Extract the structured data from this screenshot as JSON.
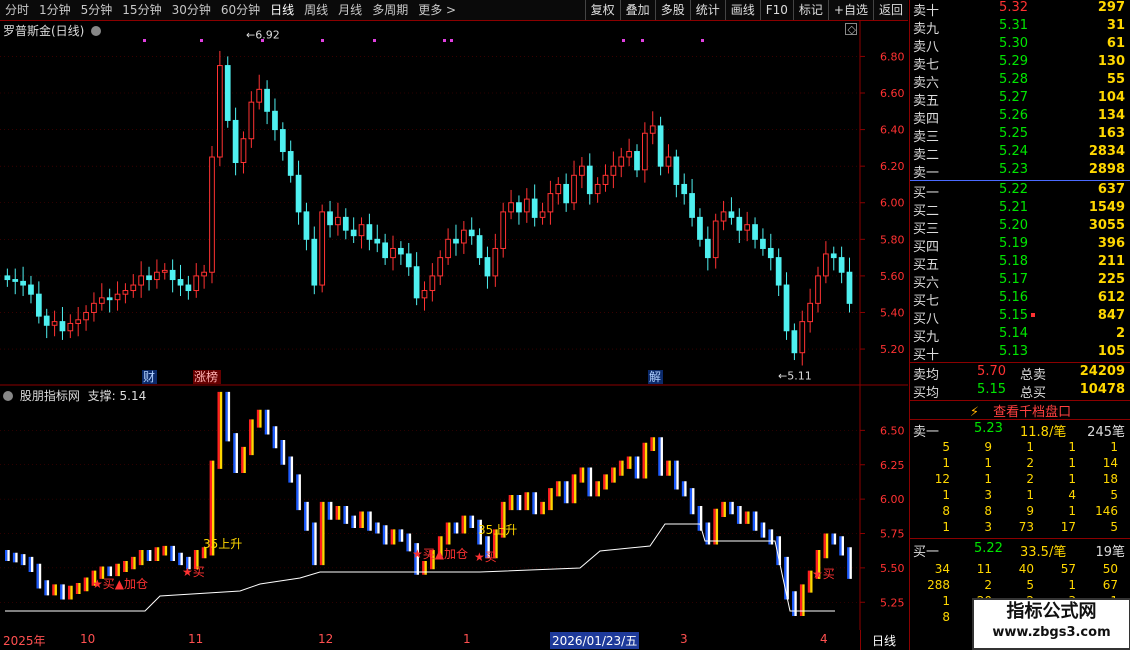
{
  "toolbar": {
    "periods": [
      "分时",
      "1分钟",
      "5分钟",
      "15分钟",
      "30分钟",
      "60分钟",
      "日线",
      "周线",
      "月线",
      "多周期",
      "更多 >"
    ],
    "active": "日线",
    "buttons": [
      "复权",
      "叠加",
      "多股",
      "统计",
      "画线",
      "F10",
      "标记",
      "+自选",
      "返回"
    ]
  },
  "main_chart": {
    "title": "罗普斯金(日线)",
    "y_ticks": [
      "6.80",
      "6.60",
      "6.40",
      "6.20",
      "6.00",
      "5.80",
      "5.60",
      "5.40",
      "5.20"
    ],
    "high_label": "6.92",
    "low_label": "5.11",
    "event_labels": [
      "财",
      "涨榜",
      "解"
    ]
  },
  "indicator": {
    "title": "股朋指标网",
    "support_label": "支撑: 5.14",
    "y_ticks": [
      "6.50",
      "6.25",
      "6.00",
      "5.75",
      "5.50",
      "5.25"
    ],
    "annotations": [
      "35上升",
      "35上升",
      "买▲加仓",
      "买",
      "买▲加仓",
      "买",
      "买"
    ]
  },
  "x_axis": {
    "labels": [
      "2025年",
      "10",
      "11",
      "12",
      "1",
      "2026/01/23/五",
      "3",
      "4"
    ],
    "period": "日线"
  },
  "order_book": {
    "asks": [
      {
        "label": "卖十",
        "price": "5.32",
        "vol": "297"
      },
      {
        "label": "卖九",
        "price": "5.31",
        "vol": "31"
      },
      {
        "label": "卖八",
        "price": "5.30",
        "vol": "61"
      },
      {
        "label": "卖七",
        "price": "5.29",
        "vol": "130"
      },
      {
        "label": "卖六",
        "price": "5.28",
        "vol": "55"
      },
      {
        "label": "卖五",
        "price": "5.27",
        "vol": "104"
      },
      {
        "label": "卖四",
        "price": "5.26",
        "vol": "134"
      },
      {
        "label": "卖三",
        "price": "5.25",
        "vol": "163"
      },
      {
        "label": "卖二",
        "price": "5.24",
        "vol": "2834"
      },
      {
        "label": "卖一",
        "price": "5.23",
        "vol": "2898"
      }
    ],
    "bids": [
      {
        "label": "买一",
        "price": "5.22",
        "vol": "637"
      },
      {
        "label": "买二",
        "price": "5.21",
        "vol": "1549"
      },
      {
        "label": "买三",
        "price": "5.20",
        "vol": "3055"
      },
      {
        "label": "买四",
        "price": "5.19",
        "vol": "396"
      },
      {
        "label": "买五",
        "price": "5.18",
        "vol": "211"
      },
      {
        "label": "买六",
        "price": "5.17",
        "vol": "225"
      },
      {
        "label": "买七",
        "price": "5.16",
        "vol": "612"
      },
      {
        "label": "买八",
        "price": "5.15",
        "vol": "847"
      },
      {
        "label": "买九",
        "price": "5.14",
        "vol": "2"
      },
      {
        "label": "买十",
        "price": "5.13",
        "vol": "105"
      }
    ],
    "avg_sell": {
      "label": "卖均",
      "price": "5.70",
      "total_label": "总卖",
      "total": "24209"
    },
    "avg_buy": {
      "label": "买均",
      "price": "5.15",
      "total_label": "总买",
      "total": "10478"
    },
    "level_button": "查看千档盘口",
    "sell1_detail": {
      "label": "卖一",
      "price": "5.23",
      "amt": "11.8/笔",
      "count": "245笔"
    },
    "sell1_queue": [
      [
        "5",
        "9",
        "1",
        "1",
        "1"
      ],
      [
        "1",
        "1",
        "2",
        "1",
        "14"
      ],
      [
        "12",
        "1",
        "2",
        "1",
        "18"
      ],
      [
        "1",
        "3",
        "1",
        "4",
        "5"
      ],
      [
        "8",
        "8",
        "9",
        "1",
        "146"
      ],
      [
        "1",
        "3",
        "73",
        "17",
        "5"
      ]
    ],
    "buy1_detail": {
      "label": "买一",
      "price": "5.22",
      "amt": "33.5/笔",
      "count": "19笔"
    },
    "buy1_queue": [
      [
        "34",
        "11",
        "40",
        "57",
        "50"
      ],
      [
        "288",
        "2",
        "5",
        "1",
        "67"
      ],
      [
        "1",
        "20",
        "2",
        "3",
        "1"
      ],
      [
        "8",
        "",
        "",
        "",
        ""
      ]
    ]
  },
  "watermark": {
    "title": "指标公式网",
    "url": "www.zbgs3.com"
  },
  "colors": {
    "up": "#ff3232",
    "down": "#00e600",
    "cyan": "#4ff0f0",
    "grid": "#8b0000",
    "yellow": "#ffd700"
  }
}
